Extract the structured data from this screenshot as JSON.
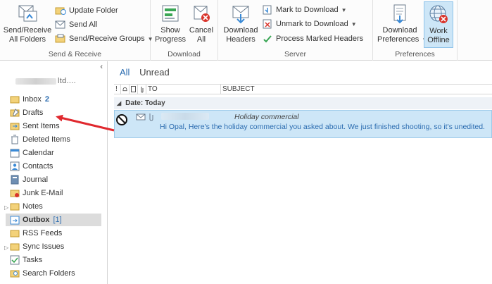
{
  "ribbon": {
    "send_receive": {
      "label": "Send & Receive",
      "big_button_line1": "Send/Receive",
      "big_button_line2": "All Folders",
      "update_folder": "Update Folder",
      "send_all": "Send All",
      "groups": "Send/Receive Groups"
    },
    "download": {
      "label": "Download",
      "show_progress_line1": "Show",
      "show_progress_line2": "Progress",
      "cancel_all_line1": "Cancel",
      "cancel_all_line2": "All"
    },
    "server": {
      "label": "Server",
      "download_headers_line1": "Download",
      "download_headers_line2": "Headers",
      "mark_to_download": "Mark to Download",
      "unmark_to_download": "Unmark to Download",
      "process_marked_headers": "Process Marked Headers"
    },
    "preferences": {
      "label": "Preferences",
      "download_prefs_line1": "Download",
      "download_prefs_line2": "Preferences",
      "work_offline_line1": "Work",
      "work_offline_line2": "Offline"
    }
  },
  "nav": {
    "collapse": "‹",
    "account_suffix": "ltd....",
    "folders": [
      {
        "label": "Inbox",
        "count": "2"
      },
      {
        "label": "Drafts",
        "count": ""
      },
      {
        "label": "Sent Items",
        "count": ""
      },
      {
        "label": "Deleted Items",
        "count": ""
      },
      {
        "label": "Calendar",
        "count": ""
      },
      {
        "label": "Contacts",
        "count": ""
      },
      {
        "label": "Journal",
        "count": ""
      },
      {
        "label": "Junk E-Mail",
        "count": ""
      },
      {
        "label": "Notes",
        "count": ""
      },
      {
        "label": "Outbox",
        "count": "[1]"
      },
      {
        "label": "RSS Feeds",
        "count": ""
      },
      {
        "label": "Sync Issues",
        "count": ""
      },
      {
        "label": "Tasks",
        "count": ""
      },
      {
        "label": "Search Folders",
        "count": ""
      }
    ]
  },
  "main": {
    "tabs": {
      "all": "All",
      "unread": "Unread"
    },
    "columns": {
      "flags": "!",
      "to": "TO",
      "subject": "SUBJECT"
    },
    "group_header": "Date: Today",
    "message": {
      "subject": "Holiday commercial",
      "preview": "Hi Opal,  Here's the holiday commercial you asked about. We just finished shooting, so it's unedited."
    }
  },
  "colors": {
    "accent": "#2b6cb0",
    "selected_row": "#cde6f7",
    "arrow": "#e0282e"
  }
}
